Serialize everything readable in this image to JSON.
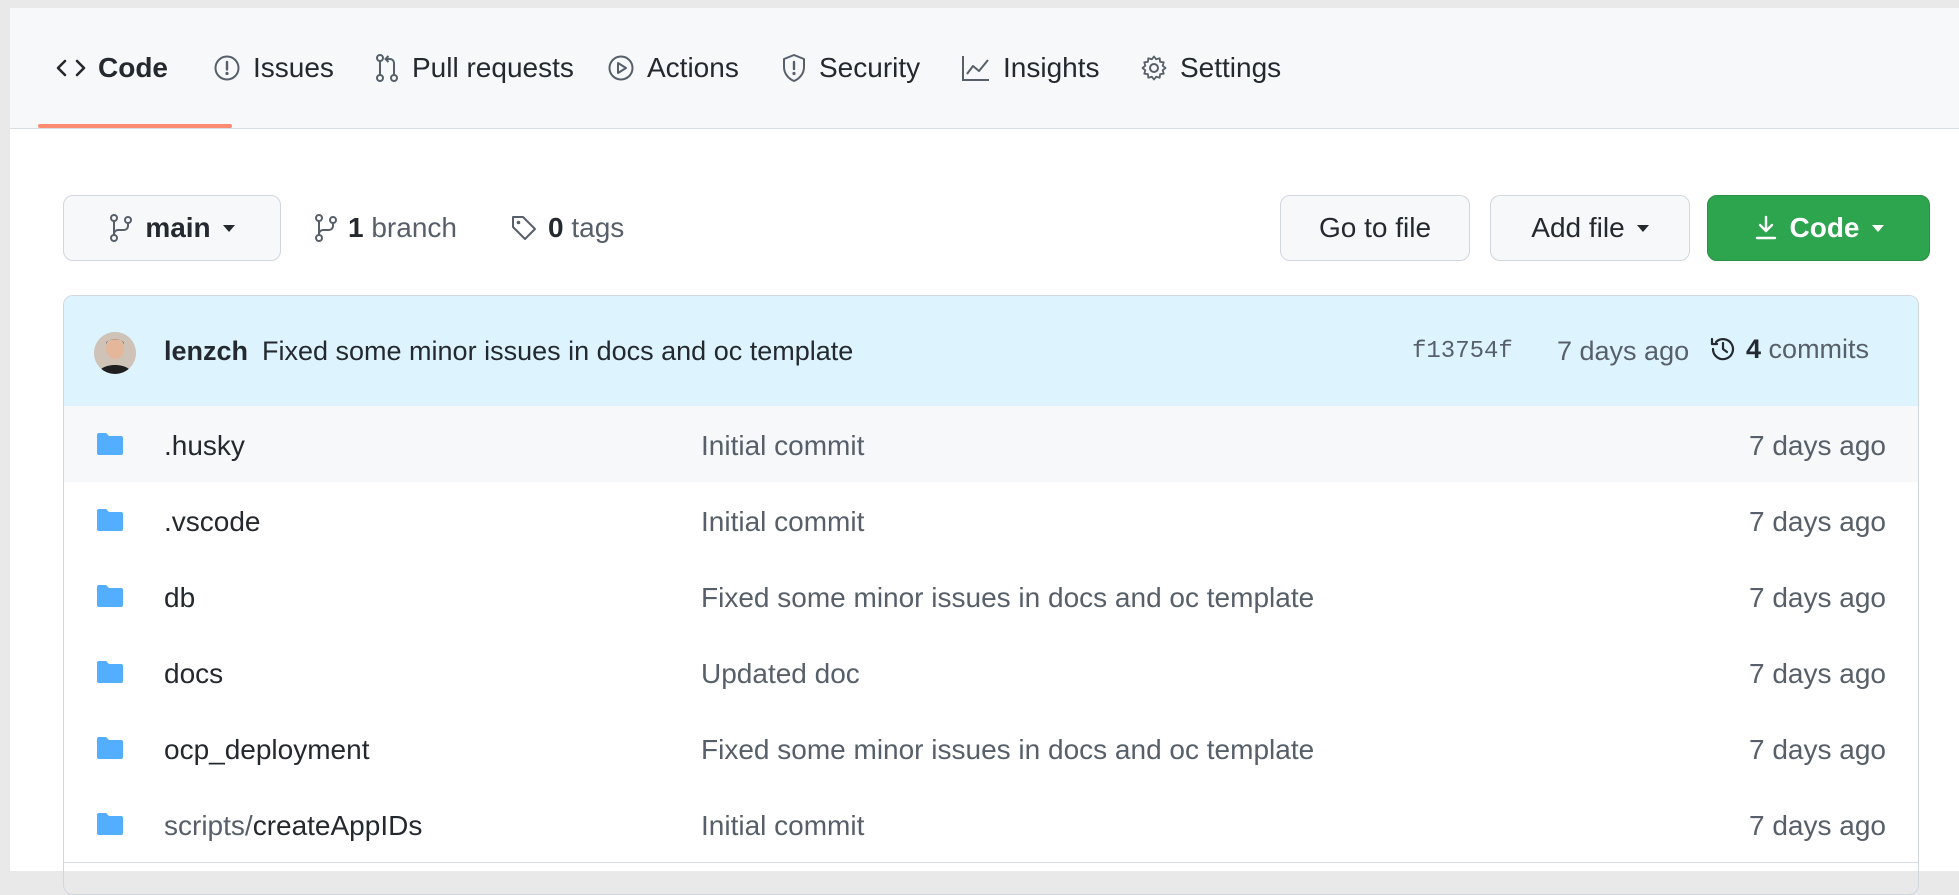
{
  "tabs": [
    {
      "label": "Code",
      "icon": "code-icon"
    },
    {
      "label": "Issues",
      "icon": "issue-icon"
    },
    {
      "label": "Pull requests",
      "icon": "pull-request-icon"
    },
    {
      "label": "Actions",
      "icon": "play-icon"
    },
    {
      "label": "Security",
      "icon": "shield-icon"
    },
    {
      "label": "Insights",
      "icon": "graph-icon"
    },
    {
      "label": "Settings",
      "icon": "gear-icon"
    }
  ],
  "selected_tab": "Code",
  "branch_bar": {
    "branch_name": "main",
    "branch_count": "1",
    "branch_label": "branch",
    "tag_count": "0",
    "tag_label": "tags",
    "go_to_file": "Go to file",
    "add_file": "Add file",
    "code_button": "Code"
  },
  "latest_commit": {
    "author": "lenzch",
    "message": "Fixed some minor issues in docs and oc template",
    "sha": "f13754f",
    "age": "7 days ago",
    "commit_count": "4",
    "commit_label": "commits"
  },
  "files": [
    {
      "prefix": "",
      "name": ".husky",
      "message": "Initial commit",
      "age": "7 days ago"
    },
    {
      "prefix": "",
      "name": ".vscode",
      "message": "Initial commit",
      "age": "7 days ago"
    },
    {
      "prefix": "",
      "name": "db",
      "message": "Fixed some minor issues in docs and oc template",
      "age": "7 days ago"
    },
    {
      "prefix": "",
      "name": "docs",
      "message": "Updated doc",
      "age": "7 days ago"
    },
    {
      "prefix": "",
      "name": "ocp_deployment",
      "message": "Fixed some minor issues in docs and oc template",
      "age": "7 days ago"
    },
    {
      "prefix": "scripts/",
      "name": "createAppIDs",
      "message": "Initial commit",
      "age": "7 days ago"
    }
  ],
  "colors": {
    "accent_underline": "#fd8c73",
    "code_button": "#2da44e",
    "commit_bar": "#ddf4ff",
    "folder_icon": "#54aeff"
  }
}
